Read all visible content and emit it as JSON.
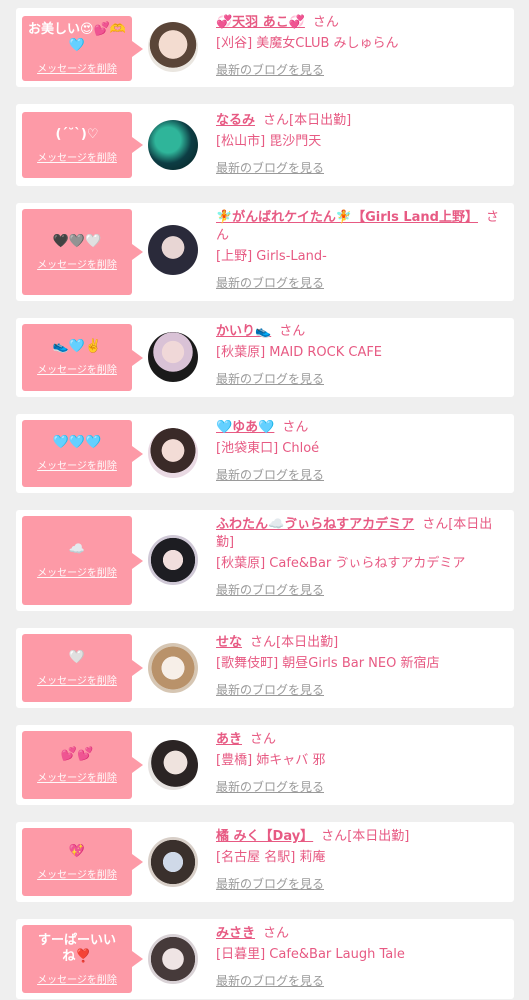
{
  "delete_label": "メッセージを削除",
  "blog_label": "最新のブログを見る",
  "san_label": "さん",
  "colors": {
    "background": "#efefef",
    "bubble": "#fd9aa7",
    "accent": "#e75a83",
    "link_gray": "#9a9a9a"
  },
  "entries": [
    {
      "message": "お美しい😍💕🫶🩵",
      "name": "💞天羽 あこ💞",
      "status": "",
      "shop": "[刈谷] 美魔女CLUB みしゅらん"
    },
    {
      "message": "(ˊ˘ˋ)♡",
      "name": "なるみ",
      "status": "[本日出勤]",
      "shop": "[松山市] 毘沙門天"
    },
    {
      "message": "🖤🩶🤍",
      "name": "🧚がんばれケイたん🧚【Girls Land上野】",
      "status": "",
      "shop": "[上野] Girls-Land-"
    },
    {
      "message": "👟🩵✌️",
      "name": "かいり👟",
      "status": "",
      "shop": "[秋葉原] MAID ROCK CAFE"
    },
    {
      "message": "🩵🩵🩵",
      "name": "🩵ゆあ🩵",
      "status": "",
      "shop": "[池袋東口] Chloé"
    },
    {
      "message": "☁️",
      "name": "ふわたん☁️ゔぃらねすアカデミア",
      "status": "[本日出勤]",
      "shop": "[秋葉原] Cafe&Bar ゔぃらねすアカデミア"
    },
    {
      "message": "🤍",
      "name": "せな",
      "status": "[本日出勤]",
      "shop": "[歌舞伎町] 朝昼Girls Bar NEO 新宿店"
    },
    {
      "message": "💕💕",
      "name": "あき",
      "status": "",
      "shop": "[豊橋] 姉キャバ 邪"
    },
    {
      "message": "💖",
      "name": "橘 みく【Day】",
      "status": "[本日出勤]",
      "shop": "[名古屋 名駅] 莉庵"
    },
    {
      "message": "すーぱーいいね❣️",
      "name": "みさき",
      "status": "",
      "shop": "[日暮里] Cafe&Bar Laugh Tale"
    }
  ]
}
